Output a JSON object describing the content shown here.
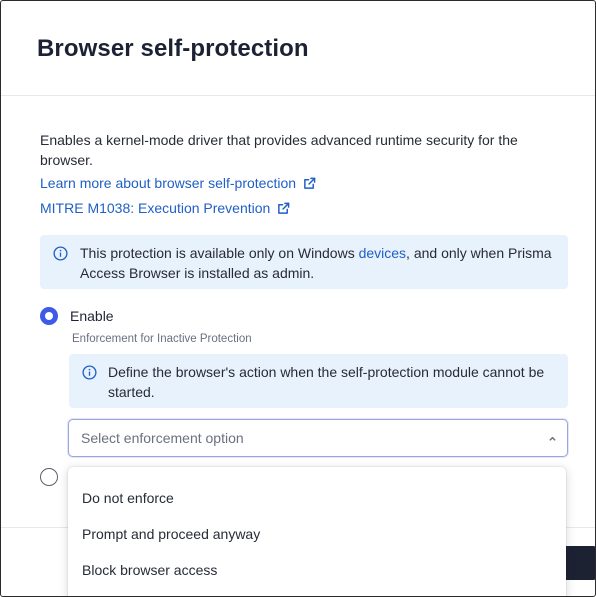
{
  "dialog": {
    "title": "Browser self-protection",
    "description": "Enables a kernel-mode driver that provides advanced runtime security for the browser.",
    "links": [
      {
        "label": "Learn more about browser self-protection"
      },
      {
        "label": "MITRE M1038: Execution Prevention"
      }
    ],
    "availability_notice": {
      "before": "This protection is available only on Windows ",
      "highlight": "devices",
      "after": ", and only when Prisma Access Browser is installed as admin."
    },
    "enable_option": {
      "label": "Enable",
      "selected": true
    },
    "enforcement": {
      "label": "Enforcement for Inactive Protection",
      "info": "Define the browser's action when the self-protection module cannot be started.",
      "select_placeholder": "Select enforcement option",
      "options": [
        "Do not enforce",
        "Prompt and proceed anyway",
        "Block browser access"
      ]
    }
  },
  "colors": {
    "accent": "#3d5ae8",
    "link": "#1f5fc7",
    "info_bg": "#e8f2fd",
    "primary_button": "#1d2233"
  },
  "icons": {
    "external_link": "external-link-icon",
    "info": "info-circle-icon",
    "chevron": "chevron-up-icon"
  }
}
